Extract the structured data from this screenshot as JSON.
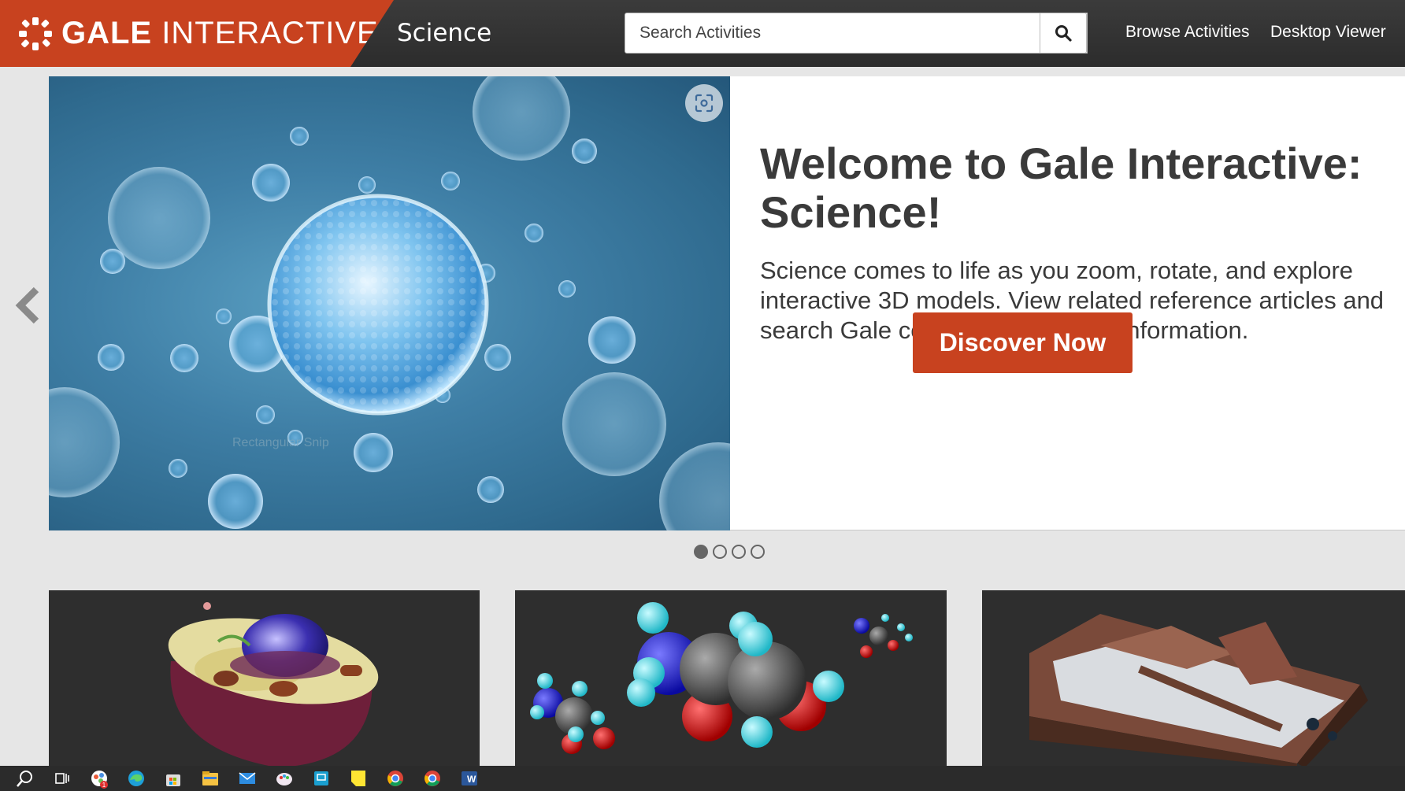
{
  "header": {
    "brand_bold": "GALE",
    "brand_light": " INTERACTIVE",
    "section_title": "Science",
    "search_placeholder": "Search Activities",
    "nav": [
      "Browse Activities",
      "Desktop Viewer"
    ]
  },
  "hero": {
    "title": "Welcome to Gale Interactive: Science!",
    "body": "Science comes to life as you zoom, rotate, and explore interactive 3D models. View related reference articles and search Gale content to find more information.",
    "button_label": "Discover Now",
    "watermark": "Rectangular Snip"
  },
  "carousel": {
    "slide_count": 4,
    "active_index": 0
  },
  "cards": [
    {
      "icon": "animal-cell-model"
    },
    {
      "icon": "molecule-model"
    },
    {
      "icon": "glacier-terrain-model"
    }
  ],
  "taskbar": {
    "icons": [
      "search-icon",
      "task-view-icon",
      "teams-icon",
      "edge-icon",
      "store-icon",
      "file-explorer-icon",
      "mail-icon",
      "paint-icon",
      "remote-desktop-icon",
      "sticky-notes-icon",
      "chrome-icon",
      "chrome-profile-icon",
      "word-icon"
    ],
    "badge": "1"
  },
  "colors": {
    "brand": "#c8421f",
    "header_bg": "#333333",
    "text": "#3a3a3a"
  }
}
